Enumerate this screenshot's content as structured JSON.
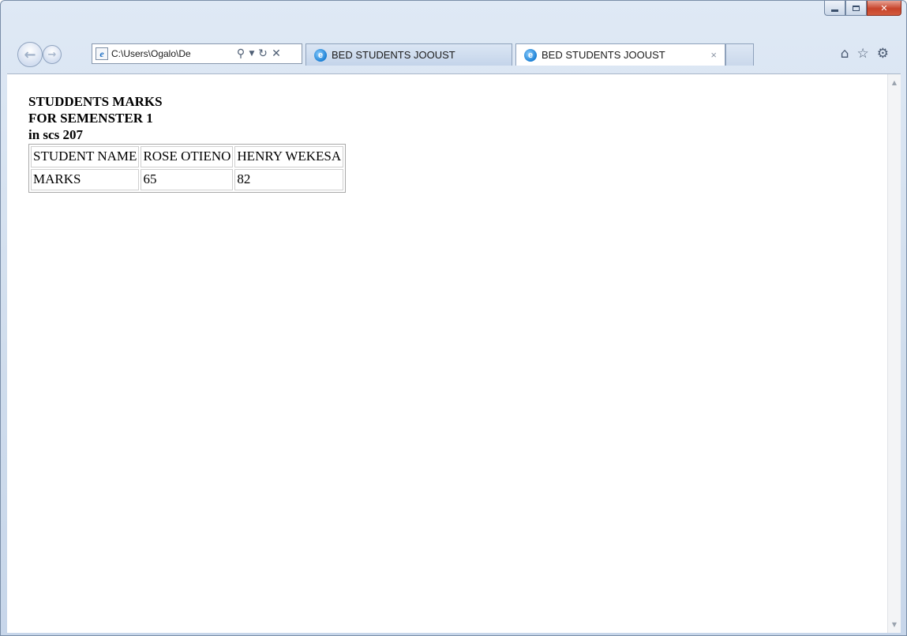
{
  "browser": {
    "address": "C:\\Users\\Ogalo\\De",
    "tabs": [
      {
        "title": "BED STUDENTS JOOUST",
        "active": false
      },
      {
        "title": "BED STUDENTS JOOUST",
        "active": true
      }
    ],
    "tab_close_glyph": "×",
    "icons": {
      "home": "⌂",
      "favorites": "☆",
      "tools": "⚙"
    }
  },
  "page": {
    "heading_lines": [
      "STUDDENTS MARKS",
      "FOR SEMENSTER 1",
      "in scs 207"
    ],
    "table": {
      "rows": [
        [
          "STUDENT NAME",
          "ROSE OTIENO",
          "HENRY WEKESA"
        ],
        [
          "MARKS",
          "65",
          "82"
        ]
      ]
    }
  },
  "colors": {
    "close_button": "#c7442b",
    "ie_blue": "#1a7fd4"
  }
}
